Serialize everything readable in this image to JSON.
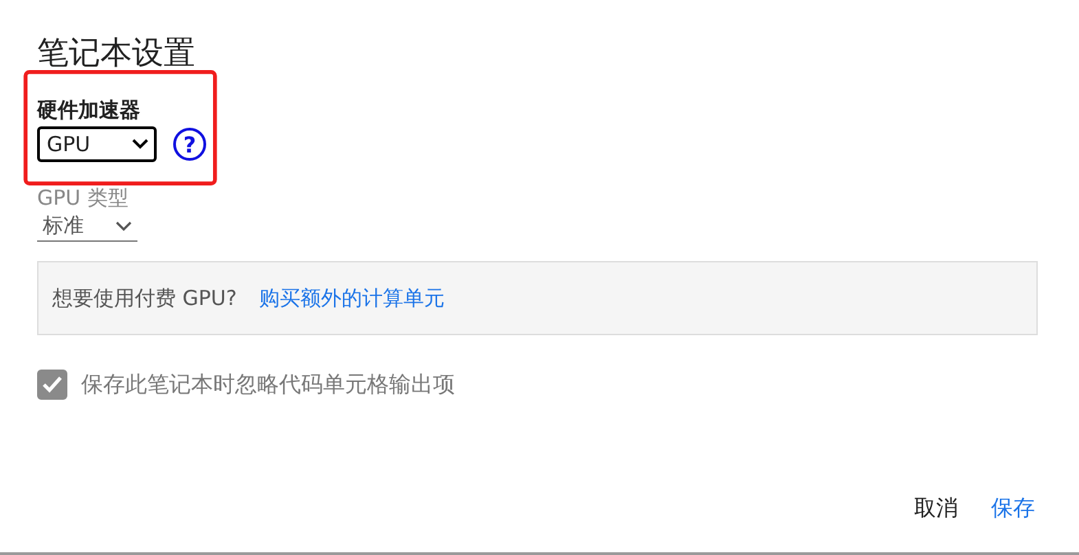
{
  "title": "笔记本设置",
  "hardware_accelerator": {
    "label": "硬件加速器",
    "value": "GPU",
    "help": "?"
  },
  "gpu_type": {
    "label": "GPU 类型",
    "value": "标准"
  },
  "notice": {
    "text": "想要使用付费 GPU?",
    "link": "购买额外的计算单元"
  },
  "omit_output": {
    "label": "保存此笔记本时忽略代码单元格输出项",
    "checked": true
  },
  "buttons": [
    {
      "label": "取消",
      "kind": "plain"
    },
    {
      "label": "保存",
      "kind": "primary"
    }
  ]
}
